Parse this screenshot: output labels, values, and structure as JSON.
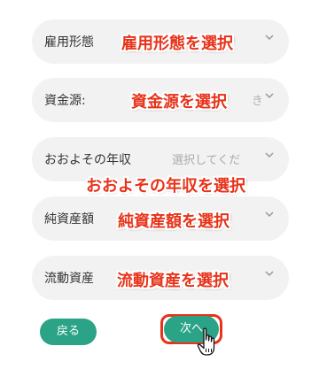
{
  "fields": [
    {
      "label": "雇用形態",
      "callout": "雇用形態を選択"
    },
    {
      "label": "資金源:",
      "callout": "資金源を選択",
      "partial": "き"
    },
    {
      "label": "おおよその年収",
      "placeholder": "選択してくだ",
      "callout": "おおよその年収を選択"
    },
    {
      "label": "純資産額",
      "callout": "純資産額を選択"
    },
    {
      "label": "流動資産",
      "callout": "流動資産を選択"
    }
  ],
  "buttons": {
    "back": "戻る",
    "next": "次へ"
  },
  "icons": {
    "dropdown": "chevron-down-icon",
    "cursor": "hand-pointer-icon"
  },
  "colors": {
    "accent": "#2aa386",
    "callout": "#e8331a",
    "field_bg": "#f2f2f2"
  }
}
